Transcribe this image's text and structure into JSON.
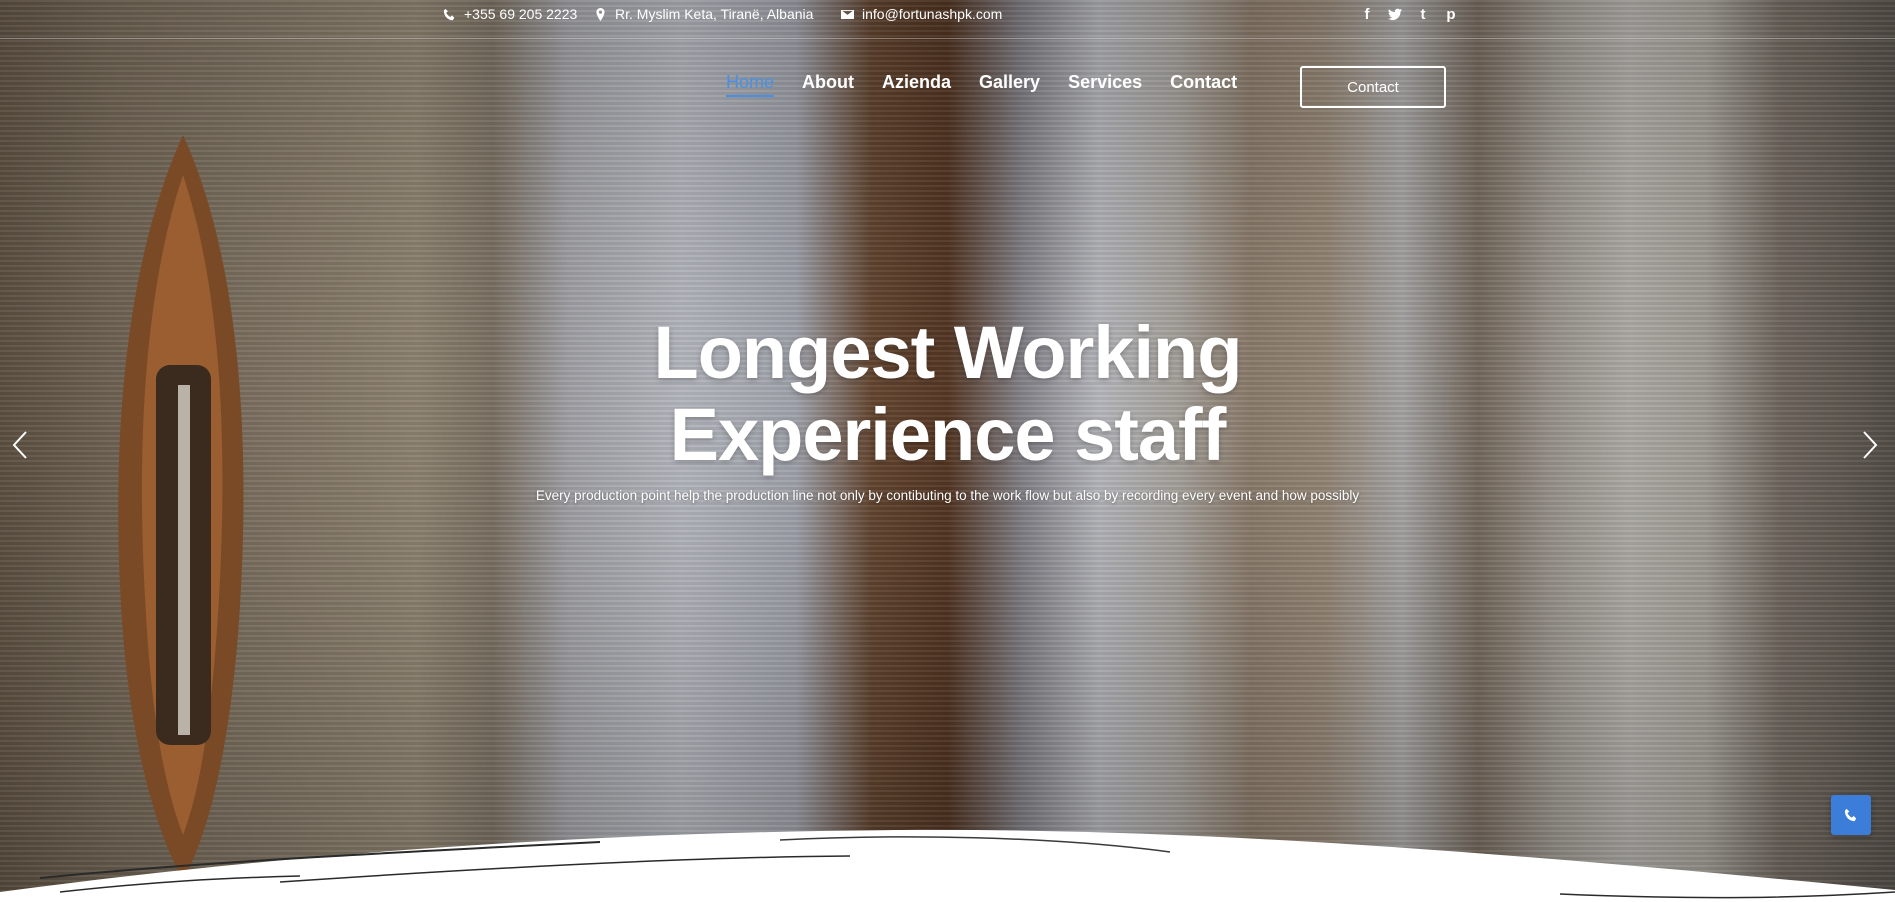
{
  "topbar": {
    "phone": "+355 69 205 2223",
    "address": "Rr. Myslim Keta, Tiranë, Albania",
    "email": "info@fortunashpk.com",
    "icons": [
      "phone-icon",
      "map-pin-icon",
      "envelope-icon"
    ],
    "socials": [
      "facebook-icon",
      "twitter-icon",
      "tumblr-icon",
      "pinterest-icon"
    ]
  },
  "nav": {
    "items": [
      "Home",
      "About",
      "Azienda",
      "Gallery",
      "Services",
      "Contact"
    ],
    "active": "Home",
    "cta": "Contact"
  },
  "hero": {
    "headline_line1": "Longest Working",
    "headline_line2": "Experience staff",
    "subtitle": "Every production point help the production line not only by contibuting to the work flow but also by recording every event and how possibly"
  },
  "colors": {
    "accent": "#4a90e2",
    "call_button": "#3b7dd8",
    "text": "#ffffff"
  }
}
